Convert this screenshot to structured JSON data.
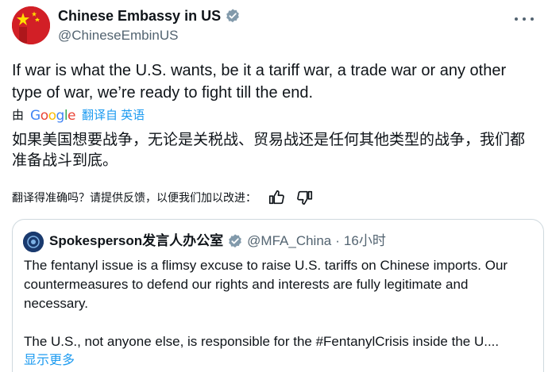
{
  "author": {
    "display_name": "Chinese Embassy in US",
    "handle": "@ChineseEmbinUS",
    "avatar_icon": "china-flag-avatar",
    "verified_color": "#829aab"
  },
  "tweet": {
    "text_en": "If war is what the U.S. wants, be it a tariff war, a trade war or any other type of war, we’re ready to fight till the end.",
    "translated_prefix": "由",
    "translated_provider": "Google",
    "translated_label": "翻译自 英语",
    "text_zh": "如果美国想要战争，无论是关税战、贸易战还是任何其他类型的战争，我们都准备战斗到底。",
    "feedback_prompt": "翻译得准确吗？请提供反馈，以便我们加以改进："
  },
  "quoted": {
    "display_name": "Spokesperson发言人办公室",
    "handle": "@MFA_China",
    "dot": "·",
    "time": "16小时",
    "verified_color": "#829aab",
    "paragraph1": "The fentanyl issue is a flimsy excuse to raise U.S. tariffs on Chinese imports. Our countermeasures to defend our rights and interests are fully legitimate and necessary.",
    "paragraph2": "The U.S., not anyone else, is responsible for the #FentanylCrisis inside the U....",
    "show_more": "显示更多"
  },
  "colors": {
    "link": "#1d9bf0",
    "secondary_text": "#536471",
    "border": "#cfd9de"
  }
}
